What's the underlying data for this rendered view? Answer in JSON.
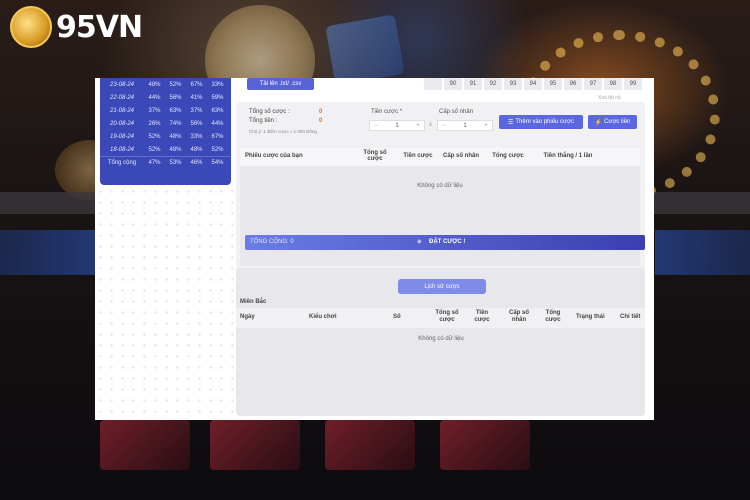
{
  "brand": {
    "logo_text": "95VN"
  },
  "stats": {
    "rows": [
      [
        "23-08-24",
        "48%",
        "52%",
        "67%",
        "33%"
      ],
      [
        "22-08-24",
        "44%",
        "56%",
        "41%",
        "59%"
      ],
      [
        "21-08-24",
        "37%",
        "63%",
        "37%",
        "63%"
      ],
      [
        "20-08-24",
        "26%",
        "74%",
        "56%",
        "44%"
      ],
      [
        "19-08-24",
        "52%",
        "48%",
        "33%",
        "67%"
      ],
      [
        "18-08-24",
        "52%",
        "48%",
        "48%",
        "52%"
      ]
    ],
    "total": [
      "Tổng cộng",
      "47%",
      "53%",
      "46%",
      "54%"
    ]
  },
  "upload": {
    "label": "Tải lên .txt/ .csv"
  },
  "numbers": [
    "",
    "90",
    "91",
    "92",
    "93",
    "94",
    "95",
    "96",
    "97",
    "98",
    "99"
  ],
  "clear_label": "Xoá tất cả",
  "summary": {
    "total_bets_label": "Tổng số cược :",
    "total_bets_value": "0",
    "total_money_label": "Tổng tiền :",
    "total_money_value": "0",
    "note": "Chú ý: 1 điểm cược = 1.000 Đồng"
  },
  "bet_amount": {
    "label": "Tiền cược *",
    "minus": "−",
    "value": "1",
    "plus": "+"
  },
  "multiplier": {
    "label": "Cấp số nhân",
    "minus": "−",
    "value": "1",
    "plus": "+"
  },
  "times": "x",
  "add_button": "Thêm vào phiếu cược",
  "quick_button": "Cược liền",
  "slip": {
    "headers": [
      "Phiếu cược của bạn",
      "Tổng số cược",
      "Tiền cược",
      "Cấp số nhân",
      "Tổng cược",
      "Tiền thắng / 1 lần"
    ],
    "empty": "Không có dữ liệu",
    "total": "TỔNG CỘNG: 0",
    "place": "ĐẶT CƯỢC !"
  },
  "history": {
    "button": "Lịch sử cược",
    "region": "Miền Bắc",
    "headers": [
      "Ngày",
      "Kiểu chơi",
      "Số",
      "Tổng số cược",
      "Tiền cược",
      "Cấp số nhân",
      "Tổng cược",
      "Trạng thái",
      "Chi tiết"
    ],
    "empty": "Không có dữ liệu"
  }
}
